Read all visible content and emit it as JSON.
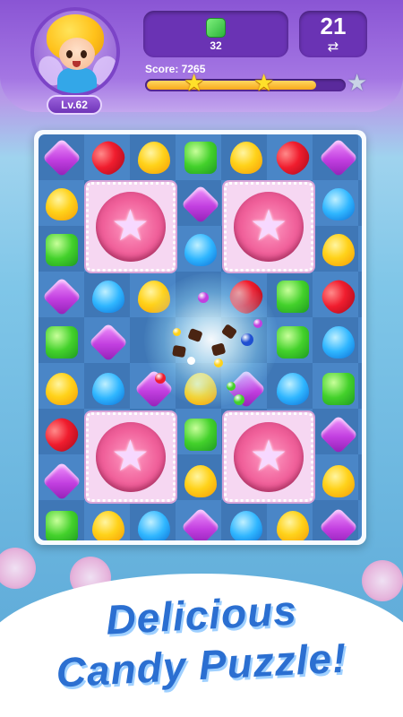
{
  "hud": {
    "level_label": "Lv.62",
    "goal_count": "32",
    "goal_icon": "green-square-candy-icon",
    "moves_left": "21",
    "swap_icon": "⇄",
    "score_label": "Score: 7265",
    "score_progress": 0.86,
    "stars_earned": 2,
    "stars_total": 3
  },
  "board": {
    "columns": 7,
    "rows": 9,
    "legend": {
      "P": "purple-candy",
      "R": "red-jelly-bean",
      "Y": "yellow-drop-candy",
      "G": "green-square-candy",
      "B": "blue-drop-candy",
      "C": "pink-cake-blocker",
      "X": "empty"
    },
    "grid": [
      [
        "P",
        "R",
        "Y",
        "G",
        "Y",
        "R",
        "P"
      ],
      [
        "Y",
        "C",
        "C",
        "P",
        "C",
        "C",
        "B"
      ],
      [
        "G",
        "C",
        "C",
        "B",
        "C",
        "C",
        "Y"
      ],
      [
        "P",
        "B",
        "Y",
        "X",
        "R",
        "G",
        "R"
      ],
      [
        "G",
        "P",
        "X",
        "X",
        "X",
        "G",
        "B"
      ],
      [
        "Y",
        "B",
        "P",
        "Y",
        "P",
        "B",
        "G"
      ],
      [
        "R",
        "C",
        "C",
        "G",
        "C",
        "C",
        "P"
      ],
      [
        "P",
        "C",
        "C",
        "Y",
        "C",
        "C",
        "Y"
      ],
      [
        "G",
        "Y",
        "B",
        "P",
        "B",
        "Y",
        "P"
      ]
    ],
    "colors": {
      "purple": "#c23fe0",
      "red": "#f01d2e",
      "yellow": "#ffd21a",
      "green": "#43d12b",
      "blue": "#2fb6ff",
      "cake": "#f0609a"
    }
  },
  "promo": {
    "line1": "Delicious",
    "line2": "Candy Puzzle!"
  }
}
